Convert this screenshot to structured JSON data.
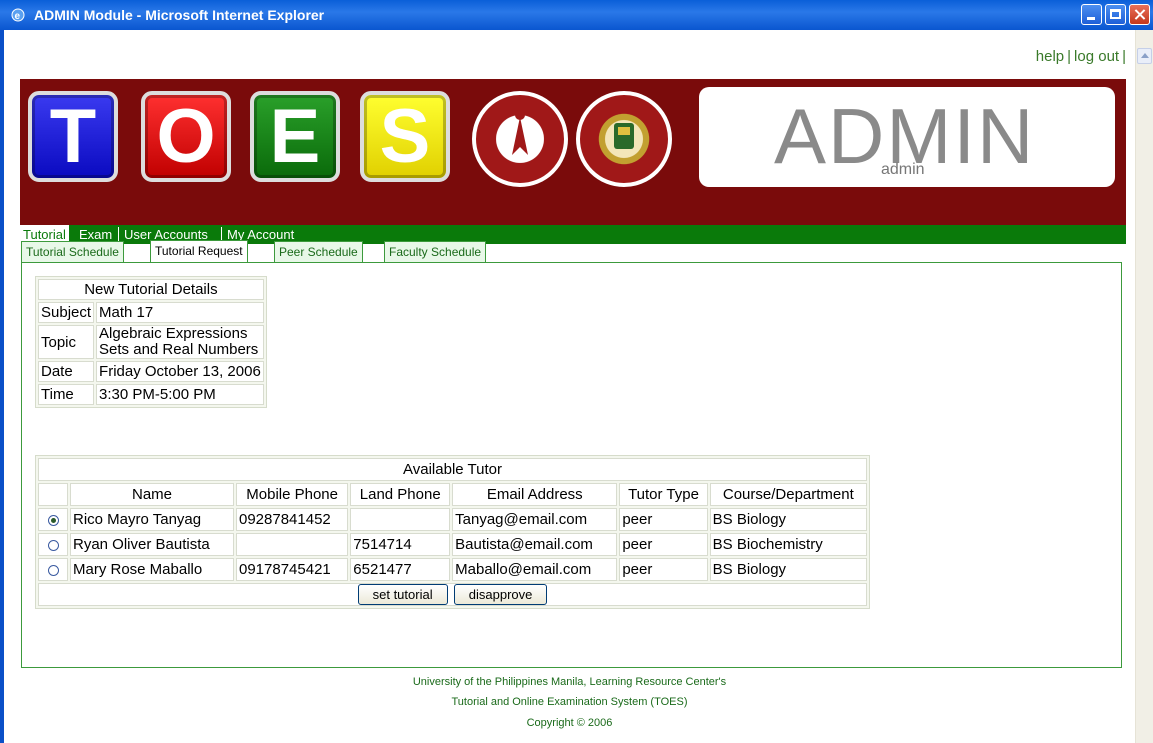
{
  "window": {
    "title": "ADMIN Module - Microsoft Internet Explorer"
  },
  "toplinks": {
    "help": "help",
    "logout": "log out"
  },
  "banner": {
    "tiles": [
      "T",
      "O",
      "E",
      "S"
    ],
    "admin_big": "ADMIN",
    "admin_small": "admin"
  },
  "nav": {
    "items": [
      "Tutorial",
      "Exam",
      "User Accounts",
      "My Account"
    ],
    "active": "Tutorial"
  },
  "tabs": {
    "items": [
      "Tutorial Schedule",
      "Tutorial Request",
      "Peer Schedule",
      "Faculty Schedule"
    ],
    "active": "Tutorial Request"
  },
  "details": {
    "header": "New Tutorial Details",
    "rows": [
      {
        "label": "Subject",
        "value": "Math 17"
      },
      {
        "label": "Topic",
        "value": "Algebraic Expressions",
        "value2": "Sets and Real Numbers"
      },
      {
        "label": "Date",
        "value": "Friday October 13, 2006"
      },
      {
        "label": "Time",
        "value": "3:30 PM-5:00 PM"
      }
    ]
  },
  "tutors": {
    "header": "Available Tutor",
    "columns": [
      "Name",
      "Mobile Phone",
      "Land Phone",
      "Email Address",
      "Tutor Type",
      "Course/Department"
    ],
    "rows": [
      {
        "selected": true,
        "name": "Rico Mayro Tanyag",
        "mobile": "09287841452",
        "land": "",
        "email": "Tanyag@email.com",
        "type": "peer",
        "course": "BS Biology"
      },
      {
        "selected": false,
        "name": "Ryan Oliver Bautista",
        "mobile": "",
        "land": "7514714",
        "email": "Bautista@email.com",
        "type": "peer",
        "course": "BS Biochemistry"
      },
      {
        "selected": false,
        "name": "Mary Rose Maballo",
        "mobile": "09178745421",
        "land": "6521477",
        "email": "Maballo@email.com",
        "type": "peer",
        "course": "BS Biology"
      }
    ],
    "buttons": {
      "set": "set tutorial",
      "disapprove": "disapprove"
    }
  },
  "footer": {
    "line1": "University of the Philippines Manila, Learning Resource Center's",
    "line2": "Tutorial and Online Examination System (TOES)",
    "line3": "Copyright © 2006"
  },
  "colors": {
    "banner": "#7a0b0b",
    "nav": "#0a7a0a",
    "tile_t": "#1a1ae0",
    "tile_o": "#e01010",
    "tile_e": "#1a8a1a",
    "tile_s": "#f0e020"
  }
}
